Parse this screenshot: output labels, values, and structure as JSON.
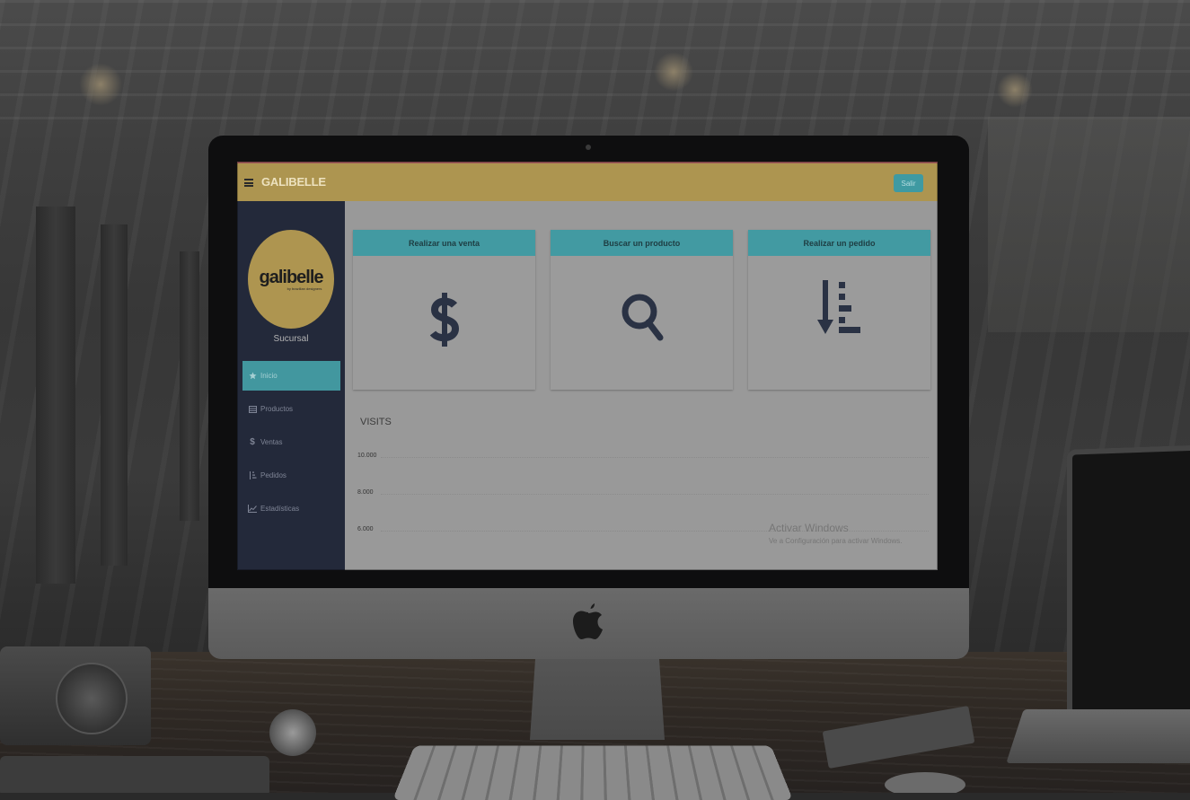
{
  "app": {
    "brand": "GALIBELLE",
    "logout_label": "Salir",
    "logo": {
      "word": "galibelle",
      "tagline": "by brazilian designers"
    },
    "branch_label": "Sucursal"
  },
  "sidebar": {
    "items": [
      {
        "label": "Inicio",
        "icon": "star-icon",
        "active": true
      },
      {
        "label": "Productos",
        "icon": "table-icon",
        "active": false
      },
      {
        "label": "Ventas",
        "icon": "dollar-icon",
        "active": false
      },
      {
        "label": "Pedidos",
        "icon": "sort-list-icon",
        "active": false
      },
      {
        "label": "Estadísticas",
        "icon": "line-chart-icon",
        "active": false
      }
    ]
  },
  "cards": [
    {
      "title": "Realizar una venta",
      "icon": "dollar-icon"
    },
    {
      "title": "Buscar un producto",
      "icon": "search-icon"
    },
    {
      "title": "Realizar un pedido",
      "icon": "sort-list-icon"
    }
  ],
  "visits": {
    "title": "VISITS",
    "y_ticks": [
      "10.000",
      "8.000",
      "6.000"
    ]
  },
  "watermark": {
    "title": "Activar Windows",
    "subtitle": "Ve a Configuración para activar Windows."
  },
  "colors": {
    "navbar": "#ad9550",
    "sidebar": "#23293a",
    "accent": "#429aa2",
    "icon": "#2a3244"
  }
}
